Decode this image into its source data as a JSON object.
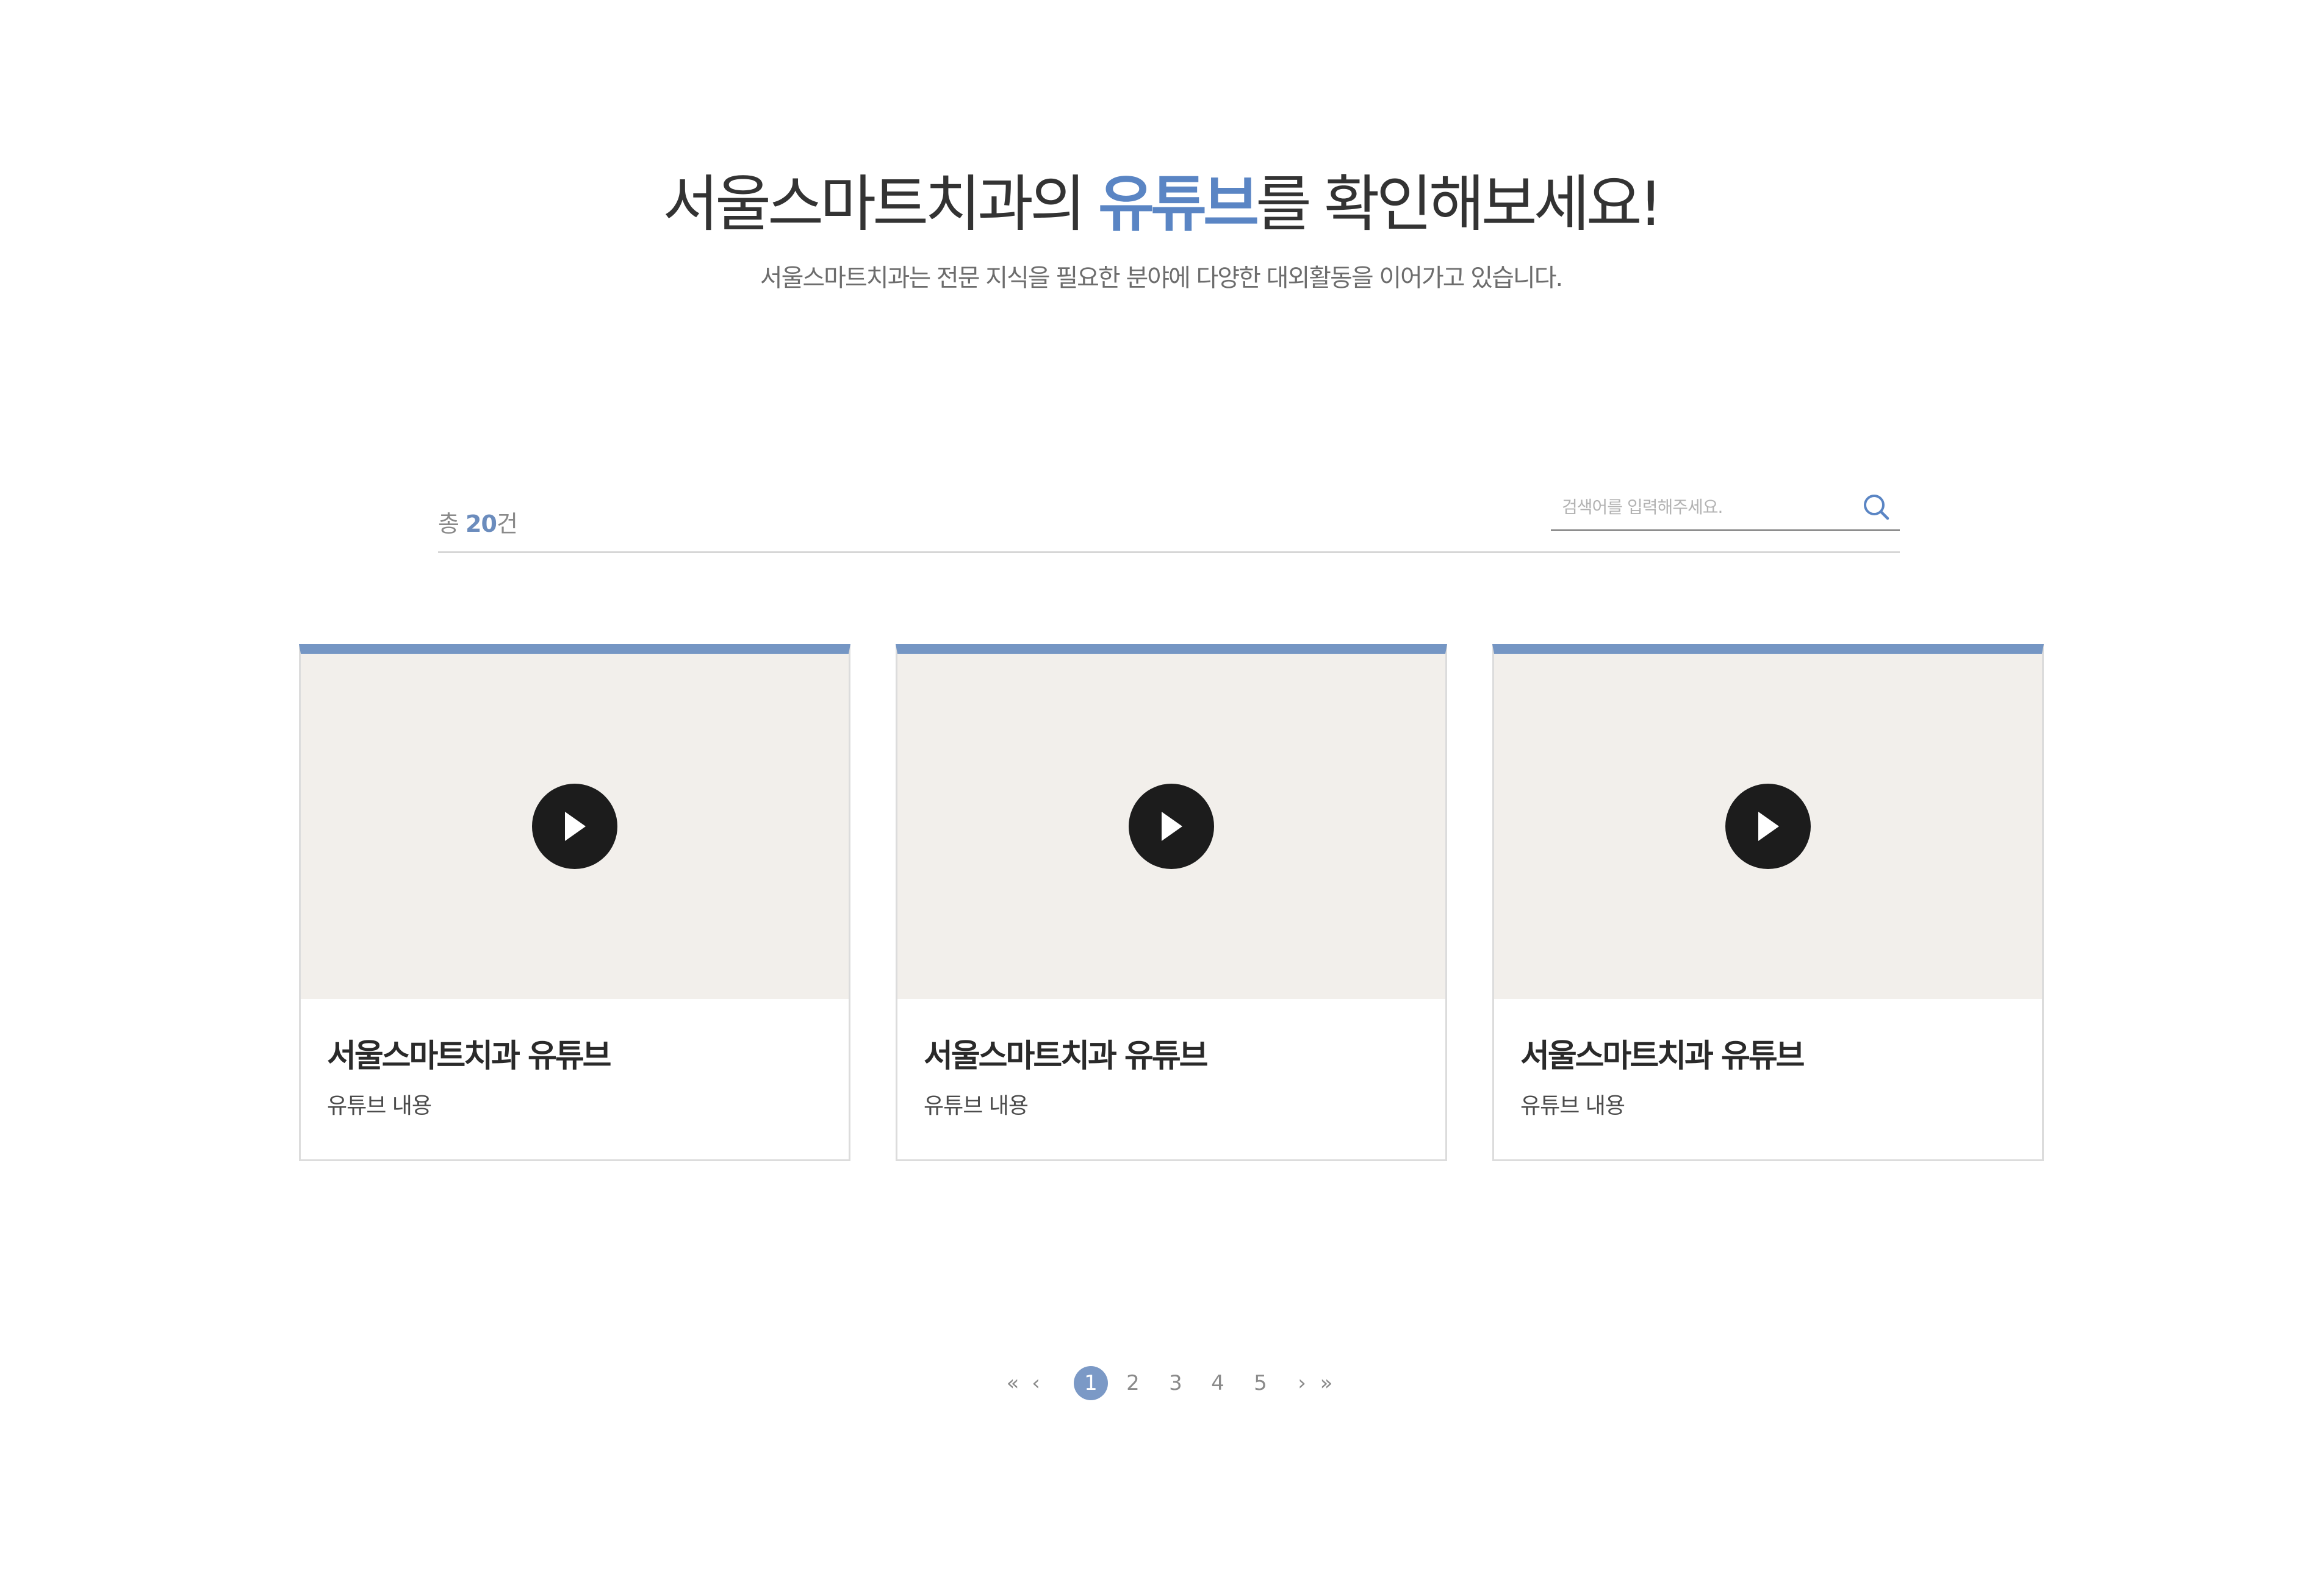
{
  "header": {
    "title_prefix": "서울스마트치과의 ",
    "title_accent": "유튜브",
    "title_suffix": "를 확인해보세요!",
    "subtitle": "서울스마트치과는 전문 지식을 필요한 분야에 다양한 대외활동을 이어가고 있습니다."
  },
  "list": {
    "total_prefix": "총 ",
    "total_count": "20",
    "total_suffix": "건"
  },
  "search": {
    "placeholder": "검색어를 입력해주세요.",
    "value": "",
    "icon": "search-icon"
  },
  "cards": [
    {
      "title": "서울스마트치과 유튜브",
      "desc": "유튜브 내용",
      "icon": "play-icon"
    },
    {
      "title": "서울스마트치과 유튜브",
      "desc": "유튜브 내용",
      "icon": "play-icon"
    },
    {
      "title": "서울스마트치과 유튜브",
      "desc": "유튜브 내용",
      "icon": "play-icon"
    }
  ],
  "pagination": {
    "first": "«",
    "prev": "‹",
    "pages": [
      "1",
      "2",
      "3",
      "4",
      "5"
    ],
    "current": "1",
    "next": "›",
    "last": "»"
  },
  "colors": {
    "accent": "#5a85c4",
    "card_top_border": "#7596c4",
    "active_page": "#7b99c6",
    "thumb_bg": "#f2efeb",
    "play_button": "#1c1c1c"
  }
}
